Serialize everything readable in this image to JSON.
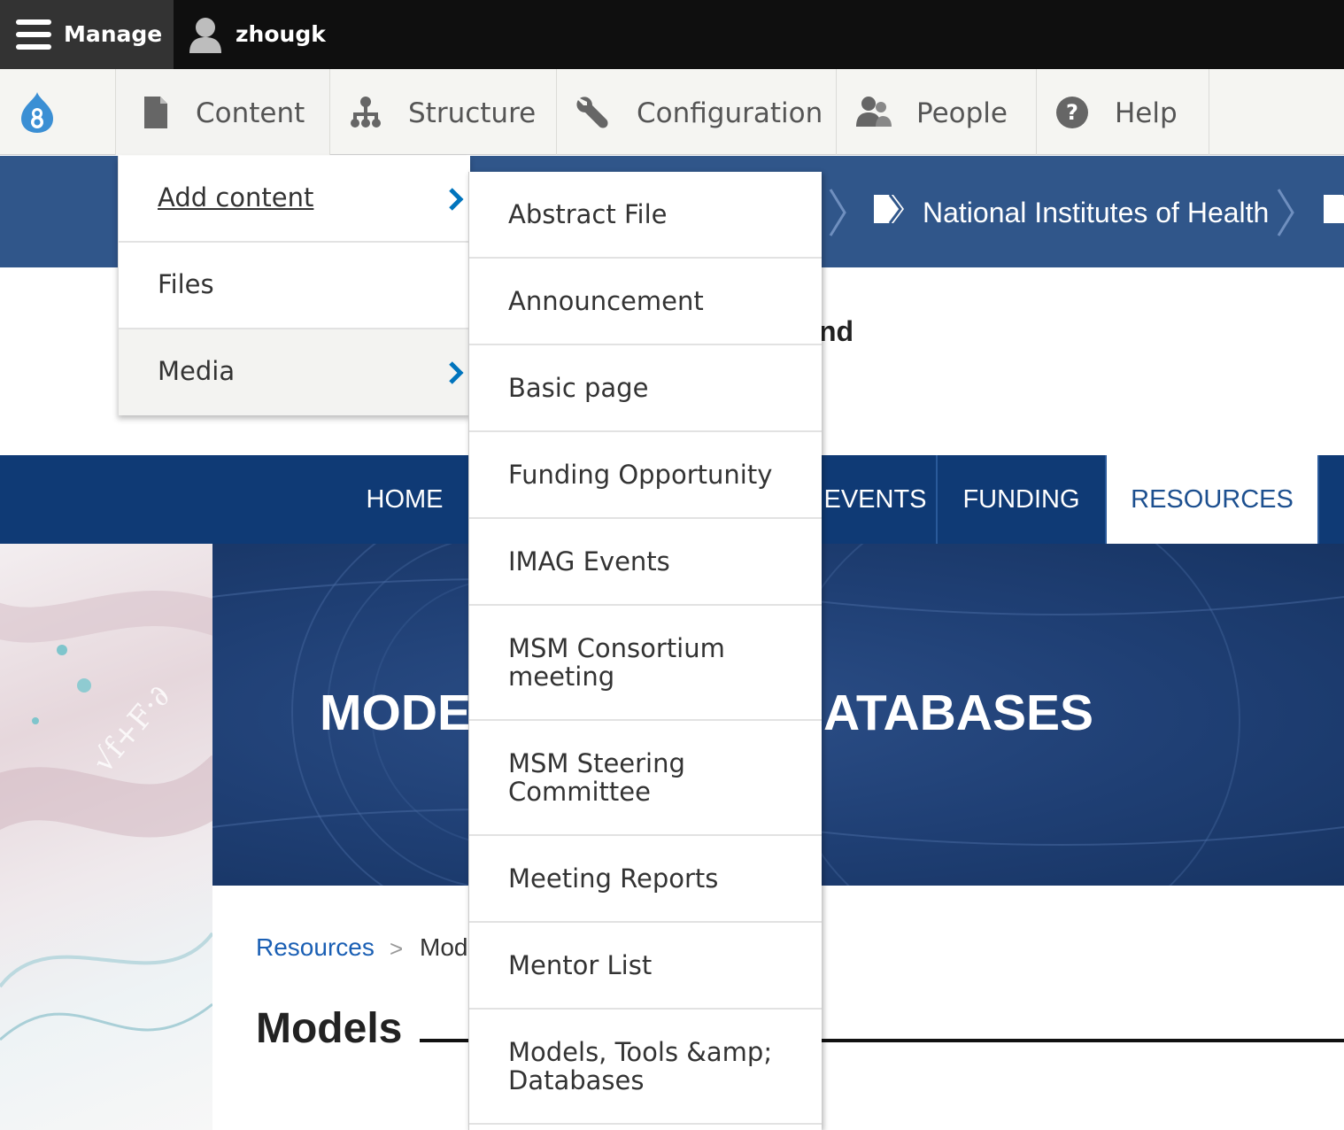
{
  "admin_bar": {
    "manage_label": "Manage",
    "user_label": "zhougk"
  },
  "toolbar": {
    "items": [
      {
        "label": "Content",
        "icon": "document-icon"
      },
      {
        "label": "Structure",
        "icon": "sitemap-icon"
      },
      {
        "label": "Configuration",
        "icon": "wrench-icon"
      },
      {
        "label": "People",
        "icon": "people-icon"
      },
      {
        "label": "Help",
        "icon": "help-icon"
      }
    ]
  },
  "content_menu": {
    "items": [
      {
        "label": "Add content",
        "has_submenu": true
      },
      {
        "label": "Files",
        "has_submenu": false
      },
      {
        "label": "Media",
        "has_submenu": true
      }
    ]
  },
  "add_content_menu": {
    "items": [
      {
        "label": "Abstract File"
      },
      {
        "label": "Announcement"
      },
      {
        "label": "Basic page"
      },
      {
        "label": "Funding Opportunity"
      },
      {
        "label": "IMAG Events"
      },
      {
        "label": "MSM Consortium meeting"
      },
      {
        "label": "MSM Steering Committee"
      },
      {
        "label": "Meeting Reports"
      },
      {
        "label": "Mentor List"
      },
      {
        "label": "Models, Tools &amp; Databases"
      }
    ]
  },
  "site_header": {
    "nih_label": "National Institutes of Health",
    "partial_text": "nd"
  },
  "main_nav": {
    "items": [
      {
        "label": "HOME"
      },
      {
        "label": "EVENTS"
      },
      {
        "label": "FUNDING"
      },
      {
        "label": "RESOURCES",
        "active": true
      }
    ]
  },
  "hero": {
    "title_left": "MODE",
    "title_right": "ATABASES"
  },
  "breadcrumb": {
    "parent": "Resources",
    "separator": ">",
    "current": "Mod"
  },
  "page": {
    "title": "Models"
  },
  "colors": {
    "admin_bar": "#0f0f0f",
    "site_blue": "#30568a",
    "nav_blue": "#0f3a75",
    "link_blue": "#1a5fb4",
    "chevron_blue": "#0074bd"
  }
}
